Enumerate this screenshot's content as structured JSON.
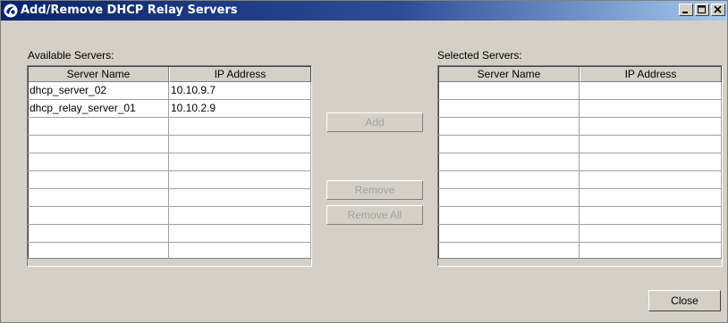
{
  "window": {
    "title": "Add/Remove DHCP Relay Servers",
    "controls": {
      "minimize": "minimize-icon",
      "maximize": "maximize-icon",
      "close": "close-icon"
    }
  },
  "available": {
    "label": "Available Servers:",
    "columns": [
      "Server Name",
      "IP Address"
    ],
    "rows": [
      [
        "dhcp_server_02",
        "10.10.9.7"
      ],
      [
        "dhcp_relay_server_01",
        "10.10.2.9"
      ],
      [
        "",
        ""
      ],
      [
        "",
        ""
      ],
      [
        "",
        ""
      ],
      [
        "",
        ""
      ],
      [
        "",
        ""
      ],
      [
        "",
        ""
      ],
      [
        "",
        ""
      ],
      [
        "",
        ""
      ]
    ]
  },
  "selected": {
    "label": "Selected Servers:",
    "columns": [
      "Server Name",
      "IP Address"
    ],
    "rows": [
      [
        "",
        ""
      ],
      [
        "",
        ""
      ],
      [
        "",
        ""
      ],
      [
        "",
        ""
      ],
      [
        "",
        ""
      ],
      [
        "",
        ""
      ],
      [
        "",
        ""
      ],
      [
        "",
        ""
      ],
      [
        "",
        ""
      ],
      [
        "",
        ""
      ]
    ]
  },
  "buttons": {
    "add": "Add",
    "remove": "Remove",
    "remove_all": "Remove All",
    "close": "Close"
  },
  "colors": {
    "title_gradient_start": "#0a246a",
    "title_gradient_end": "#a6caf0",
    "dialog_bg": "#d4d0c8",
    "disabled_text": "#a0a0a0"
  }
}
